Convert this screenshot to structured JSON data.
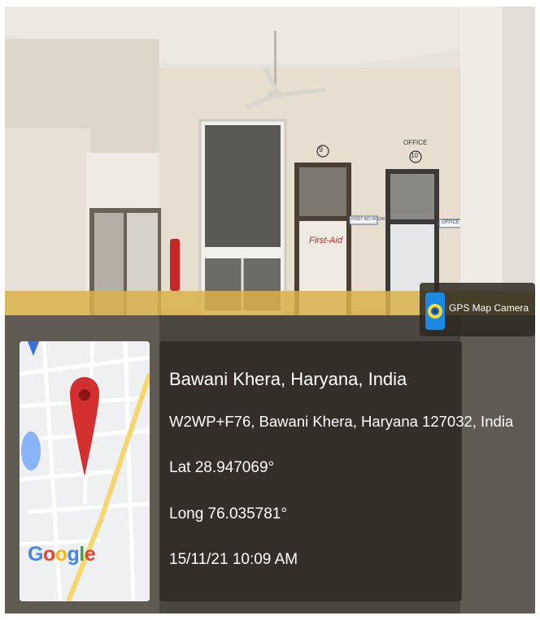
{
  "app": {
    "name": "GPS Map Camera",
    "icon": "camera-lens-icon"
  },
  "map": {
    "provider_logo": "Google",
    "marker": "map-pin-icon"
  },
  "location": {
    "place": "Bawani Khera, Haryana, India",
    "address": "W2WP+F76, Bawani Khera, Haryana 127032, India",
    "lat": "Lat 28.947069°",
    "long": "Long 76.035781°",
    "timestamp": "15/11/21 10:09 AM"
  },
  "scene": {
    "room_number_1": "9",
    "room_number_2": "10",
    "office_label": "OFFICE",
    "first_aid_sign": "FIRST AID ROOM",
    "door_sign": "First-Aid",
    "office_sign": "OFFICE"
  },
  "colors": {
    "wall": "#e6ddd0",
    "dado": "#d8b04a",
    "overlay": "#2d2821",
    "marker": "#d32f2f"
  }
}
